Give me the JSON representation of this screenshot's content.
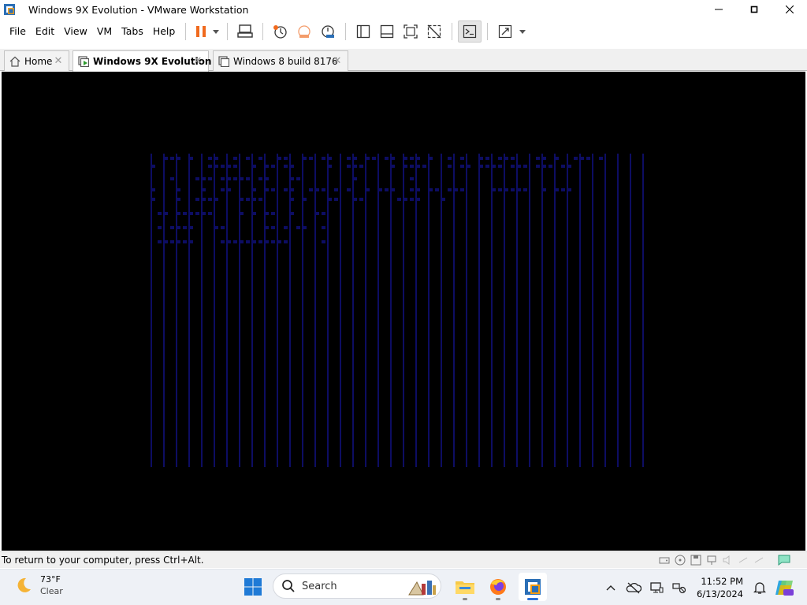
{
  "window": {
    "title": "Windows 9X Evolution - VMware Workstation",
    "app_icon": "vmware-workstation-icon",
    "controls": [
      "minimize-icon",
      "maximize-icon",
      "close-icon"
    ]
  },
  "menu": {
    "items": [
      "File",
      "Edit",
      "View",
      "VM",
      "Tabs",
      "Help"
    ]
  },
  "toolbar": {
    "buttons": [
      {
        "icon": "pause-icon",
        "color": "#f06a1e"
      },
      {
        "icon": "send-ctrl-alt-del-icon"
      },
      {
        "icon": "snapshot-take-icon"
      },
      {
        "icon": "snapshot-revert-icon"
      },
      {
        "icon": "snapshot-manager-icon"
      },
      {
        "icon": "show-library-icon"
      },
      {
        "icon": "thumbnail-bar-icon"
      },
      {
        "icon": "full-screen-icon"
      },
      {
        "icon": "unity-icon"
      },
      {
        "icon": "console-view-icon"
      },
      {
        "icon": "stretch-guest-icon"
      }
    ]
  },
  "tabs": [
    {
      "label": "Home",
      "icon": "home-icon",
      "active": false
    },
    {
      "label": "Windows 9X Evolution",
      "icon": "vm-running-icon",
      "active": true
    },
    {
      "label": "Windows 8 build 8176",
      "icon": "vm-icon",
      "active": false
    }
  ],
  "vm": {
    "background": "#000000",
    "pattern_color": "#0d0d63"
  },
  "statusbar": {
    "hint": "To return to your computer, press Ctrl+Alt.",
    "icons": [
      "hard-disk-icon",
      "cd-drive-icon",
      "floppy-icon",
      "network-adapter-icon",
      "sound-icon",
      "usb-icon",
      "message-icon"
    ]
  },
  "taskbar": {
    "weather": {
      "temp": "73°F",
      "condition": "Clear",
      "icon": "moon-icon"
    },
    "search_label": "Search",
    "apps": [
      "start-icon",
      "file-explorer-icon",
      "firefox-icon",
      "vmware-workstation-icon"
    ],
    "tray_icons": [
      "chevron-up-icon",
      "onedrive-offline-icon",
      "display-icon",
      "network-sound-icon"
    ],
    "clock": {
      "time": "11:52 PM",
      "date": "6/13/2024"
    },
    "notification_icon": "bell-icon",
    "copilot_icon": "copilot-icon"
  }
}
